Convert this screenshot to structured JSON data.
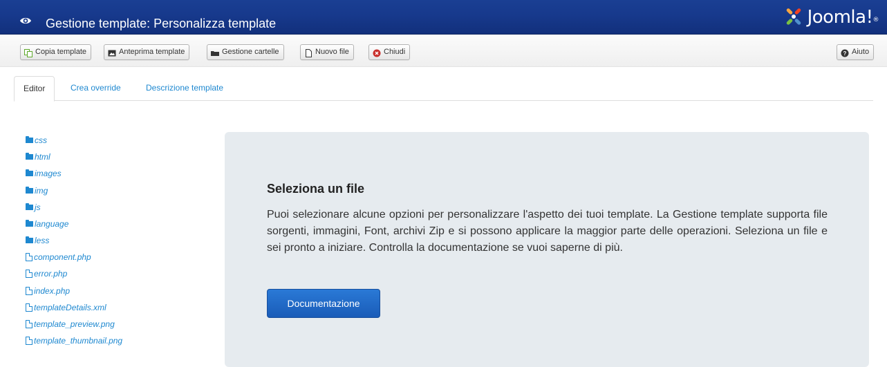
{
  "header": {
    "title": "Gestione template: Personalizza template",
    "logo_text": "Joomla!",
    "logo_mark": "®",
    "color": "#17398c"
  },
  "toolbar": {
    "copy_label": "Copia template",
    "preview_label": "Anteprima template",
    "folders_label": "Gestione cartelle",
    "new_file_label": "Nuovo file",
    "close_label": "Chiudi",
    "help_label": "Aiuto"
  },
  "tabs": [
    {
      "label": "Editor",
      "active": true
    },
    {
      "label": "Crea override",
      "active": false
    },
    {
      "label": "Descrizione template",
      "active": false
    }
  ],
  "tree": {
    "folders": [
      "css",
      "html",
      "images",
      "img",
      "js",
      "language",
      "less"
    ],
    "files": [
      "component.php",
      "error.php",
      "index.php",
      "templateDetails.xml",
      "template_preview.png",
      "template_thumbnail.png"
    ]
  },
  "hero": {
    "heading": "Seleziona un file",
    "body": "Puoi selezionare alcune opzioni per personalizzare l'aspetto dei tuoi template. La Gestione template supporta file sorgenti, immagini, Font, archivi Zip e si possono applicare la maggior parte delle operazioni. Seleziona un file e sei pronto a iniziare. Controlla la documentazione se vuoi saperne di più.",
    "button_label": "Documentazione"
  },
  "colors": {
    "link": "#1e88d0",
    "primary_button": "#1a5cb8",
    "close_icon": "#c9302c"
  }
}
